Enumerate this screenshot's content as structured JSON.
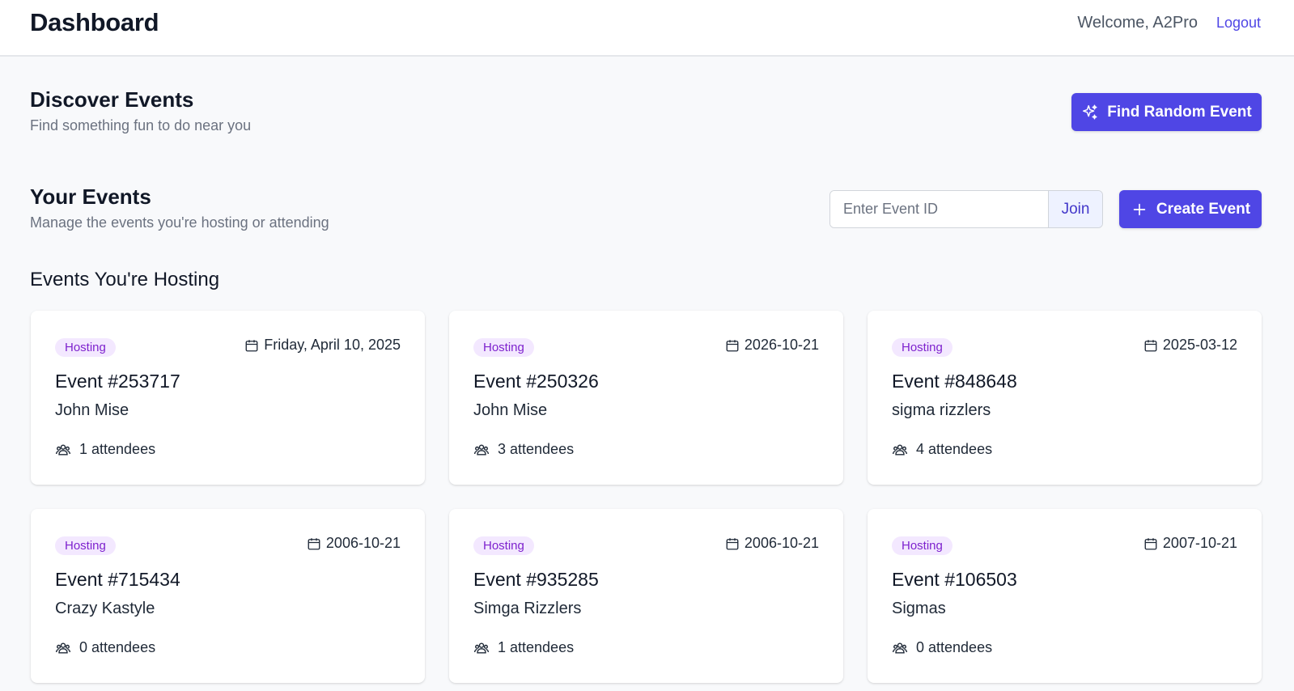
{
  "header": {
    "title": "Dashboard",
    "welcome": "Welcome, A2Pro",
    "logout_label": "Logout"
  },
  "discover": {
    "title": "Discover Events",
    "subtitle": "Find something fun to do near you",
    "random_button_label": "Find Random Event"
  },
  "your_events": {
    "title": "Your Events",
    "subtitle": "Manage the events you're hosting or attending",
    "join_placeholder": "Enter Event ID",
    "join_label": "Join",
    "create_label": "Create Event"
  },
  "hosting": {
    "heading": "Events You're Hosting",
    "events": [
      {
        "badge": "Hosting",
        "date": "Friday, April 10, 2025",
        "title": "Event #253717",
        "name": "John Mise",
        "attendees": "1 attendees"
      },
      {
        "badge": "Hosting",
        "date": "2026-10-21",
        "title": "Event #250326",
        "name": "John Mise",
        "attendees": "3 attendees"
      },
      {
        "badge": "Hosting",
        "date": "2025-03-12",
        "title": "Event #848648",
        "name": "sigma rizzlers",
        "attendees": "4 attendees"
      },
      {
        "badge": "Hosting",
        "date": "2006-10-21",
        "title": "Event #715434",
        "name": "Crazy Kastyle",
        "attendees": "0 attendees"
      },
      {
        "badge": "Hosting",
        "date": "2006-10-21",
        "title": "Event #935285",
        "name": "Simga Rizzlers",
        "attendees": "1 attendees"
      },
      {
        "badge": "Hosting",
        "date": "2007-10-21",
        "title": "Event #106503",
        "name": "Sigmas",
        "attendees": "0 attendees"
      }
    ]
  },
  "colors": {
    "accent": "#4f46e5",
    "badge_bg": "#f3e8ff",
    "badge_text": "#7e22ce",
    "background": "#f8f9fb"
  },
  "icons": {
    "random": "sparkles-icon",
    "create": "plus-icon",
    "date": "calendar-icon",
    "attendees": "users-icon"
  }
}
